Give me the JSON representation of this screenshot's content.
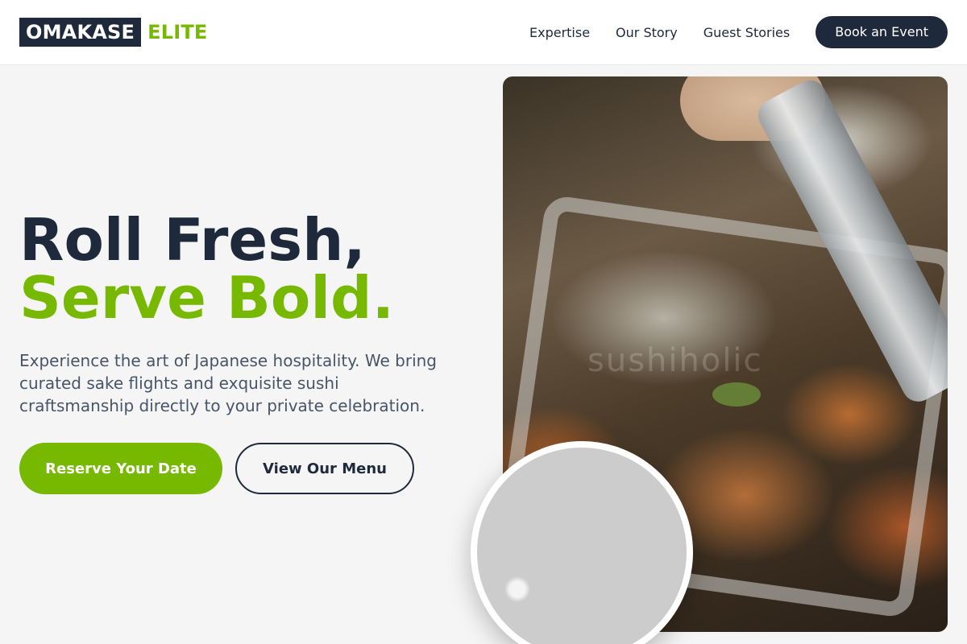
{
  "brand": {
    "name_box": "OMAKASE",
    "name_accent": "ELITE"
  },
  "nav": {
    "links": [
      "Expertise",
      "Our Story",
      "Guest Stories"
    ],
    "cta": "Book an Event"
  },
  "hero": {
    "headline_line1": "Roll Fresh,",
    "headline_line2": "Serve Bold.",
    "subtext": "Experience the art of Japanese hospitality. We bring curated sake flights and exquisite sushi craftsmanship directly to your private celebration.",
    "primary_button": "Reserve Your Date",
    "secondary_button": "View Our Menu",
    "image_watermark": "sushiholic"
  },
  "colors": {
    "navy": "#1e293b",
    "accent_green": "#76b900",
    "body_text": "#475569",
    "background": "#f5f5f5"
  },
  "icons": {
    "hero_photo": "grilled-skewers-photo",
    "platter_photo": "charcuterie-platter-photo"
  }
}
